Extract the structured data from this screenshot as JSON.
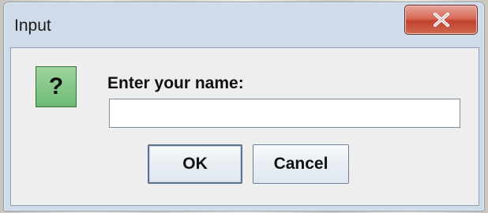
{
  "window": {
    "title": "Input",
    "close_icon": "close-icon"
  },
  "dialog": {
    "icon": "question-icon",
    "icon_glyph": "?",
    "prompt": "Enter your name:",
    "name_input": {
      "value": "",
      "placeholder": ""
    },
    "ok_label": "OK",
    "cancel_label": "Cancel"
  },
  "colors": {
    "close_button": "#c1412f",
    "question_icon_bg": "#6fba73",
    "frame": "#cfdbe9"
  }
}
